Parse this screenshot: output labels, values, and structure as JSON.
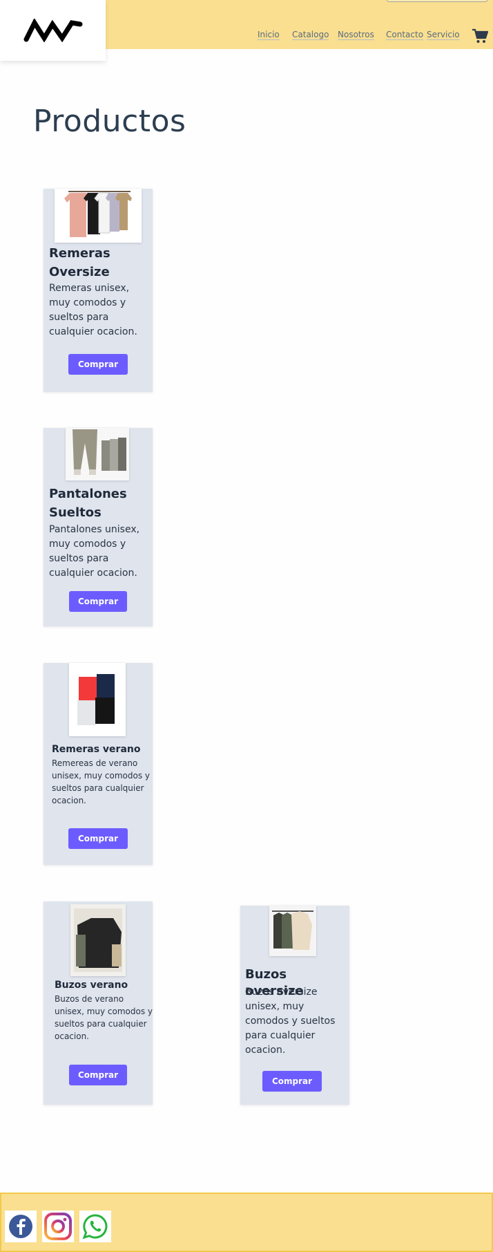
{
  "header": {
    "logo_text": "MW",
    "nav": [
      "Inicio",
      "Catalogo",
      "Nosotros",
      "Contacto",
      "Servicio"
    ]
  },
  "page_title": "Productos",
  "products": [
    {
      "title": "Remeras Oversize",
      "description": "Remeras unisex, muy comodos y sueltos para cualquier ocacion.",
      "button": "Comprar",
      "image_icon": "tshirts-rack-icon"
    },
    {
      "title": "Pantalones Sueltos",
      "description": "Pantalones unisex, muy comodos y sueltos para cualquier ocacion.",
      "button": "Comprar",
      "image_icon": "pants-icon"
    },
    {
      "title": "Remeras verano",
      "description": "Remereas de verano unisex, muy comodos y sueltos para cualquier ocacion.",
      "button": "Comprar",
      "image_icon": "folded-tshirts-icon"
    },
    {
      "title": "Buzos verano",
      "description": "Buzos de verano unisex, muy comodos y sueltos para cualquier ocacion.",
      "button": "Comprar",
      "image_icon": "sweatshirts-icon"
    },
    {
      "title": "Buzos oversize",
      "description": "Buzos oversize unisex, muy comodos y sueltos para cualquier ocacion.",
      "button": "Comprar",
      "image_icon": "hoodies-rack-icon"
    }
  ],
  "footer": {
    "social": [
      "facebook-icon",
      "instagram-icon",
      "whatsapp-icon"
    ]
  },
  "colors": {
    "header_bg": "#f9df8f",
    "card_bg": "#dfe4ed",
    "button": "#6c5cff",
    "title": "#2c3e50"
  }
}
